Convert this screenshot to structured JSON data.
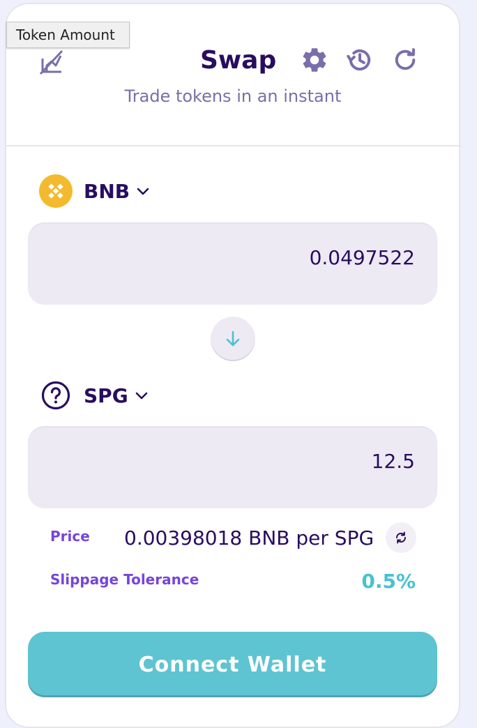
{
  "tooltip": {
    "text": "Token Amount"
  },
  "header": {
    "title": "Swap",
    "subtitle": "Trade tokens in an instant"
  },
  "from": {
    "symbol": "BNB",
    "amount": "0.0497522",
    "logo": "bnb-logo"
  },
  "to": {
    "symbol": "SPG",
    "amount": "12.5",
    "logo": "unknown-token-icon"
  },
  "price": {
    "label": "Price",
    "value": "0.00398018 BNB per SPG"
  },
  "slippage": {
    "label": "Slippage Tolerance",
    "value": "0.5%"
  },
  "actions": {
    "connect_label": "Connect Wallet"
  },
  "colors": {
    "primary_text": "#280d5f",
    "secondary": "#7645d9",
    "accent": "#48c1d1",
    "subtle_text": "#7a6eaa",
    "input_bg": "#eeeaf4",
    "bnb_gold": "#f0b90b"
  }
}
